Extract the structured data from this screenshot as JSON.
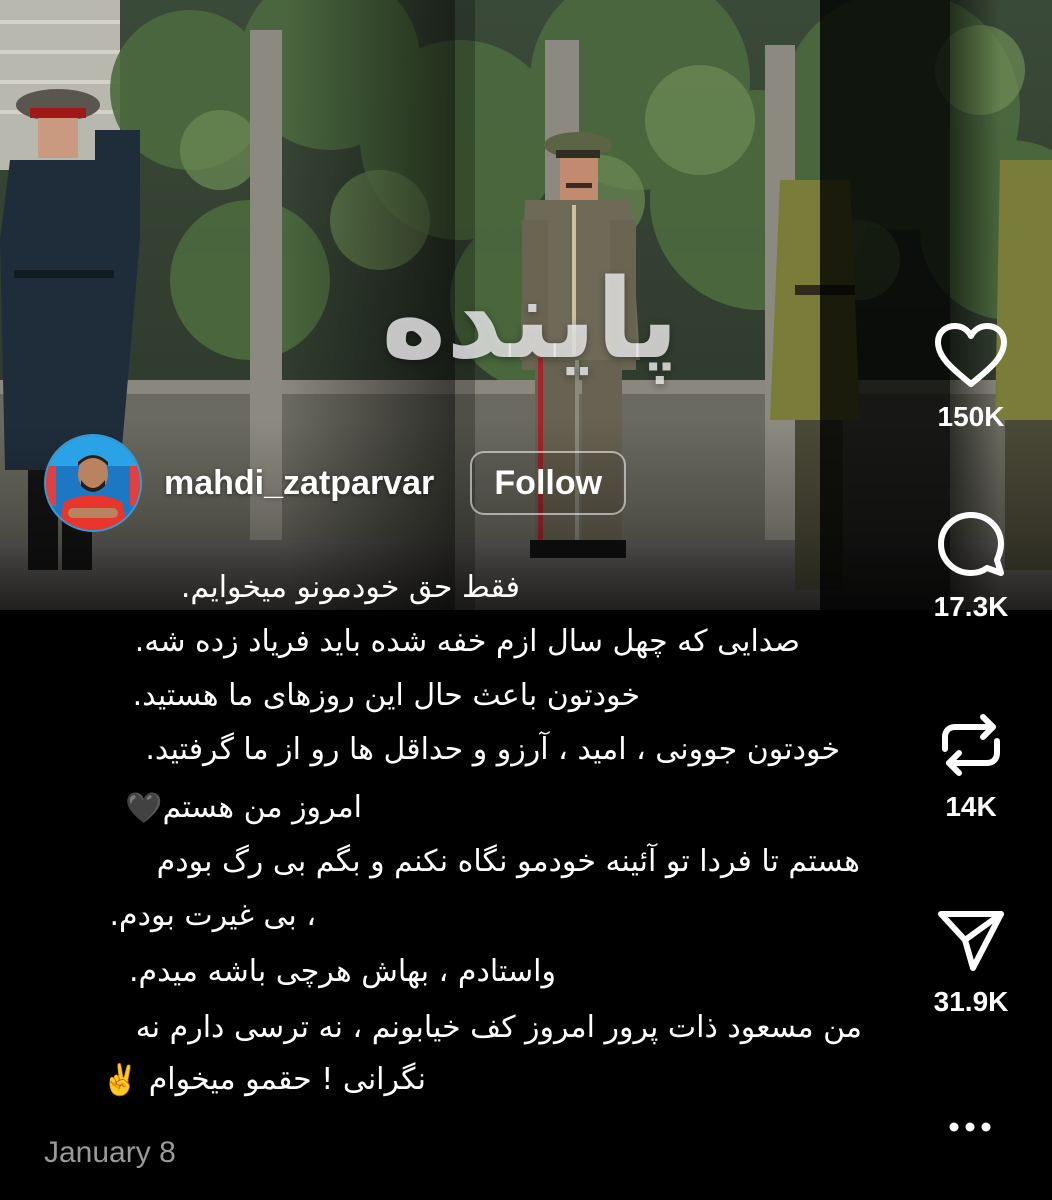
{
  "video": {
    "overlay_title": "پاینده"
  },
  "author": {
    "username": "mahdi_zatparvar",
    "follow_label": "Follow"
  },
  "caption": {
    "lines": [
      "فقط حق خودمونو میخوایم.",
      "صدایی که چهل سال ازم خفه شده باید فریاد زده شه.",
      "خودتون باعث حال این روزهای ما هستید.",
      "خودتون جوونی ، امید ، آرزو و حداقل ها رو از ما گرفتید.",
      "امروز من هستم",
      "هستم تا فردا تو آئینه خودمو نگاه نکنم و بگم بی رگ بودم",
      "، بی غیرت بودم.",
      "واستادم ، بهاش هرچی باشه میدم.",
      "من مسعود ذات پرور امروز کف خیابونم ، نه ترسی دارم نه",
      "نگرانی ! حقمو میخوام"
    ],
    "emoji_heart": "🖤",
    "emoji_victory": "✌️"
  },
  "date": "January 8",
  "actions": {
    "likes": "150K",
    "comments": "17.3K",
    "reposts": "14K",
    "shares": "31.9K"
  },
  "icons": {
    "like": "heart-icon",
    "comment": "comment-bubble-icon",
    "repost": "repost-icon",
    "share": "send-icon",
    "more": "more-options-icon"
  }
}
